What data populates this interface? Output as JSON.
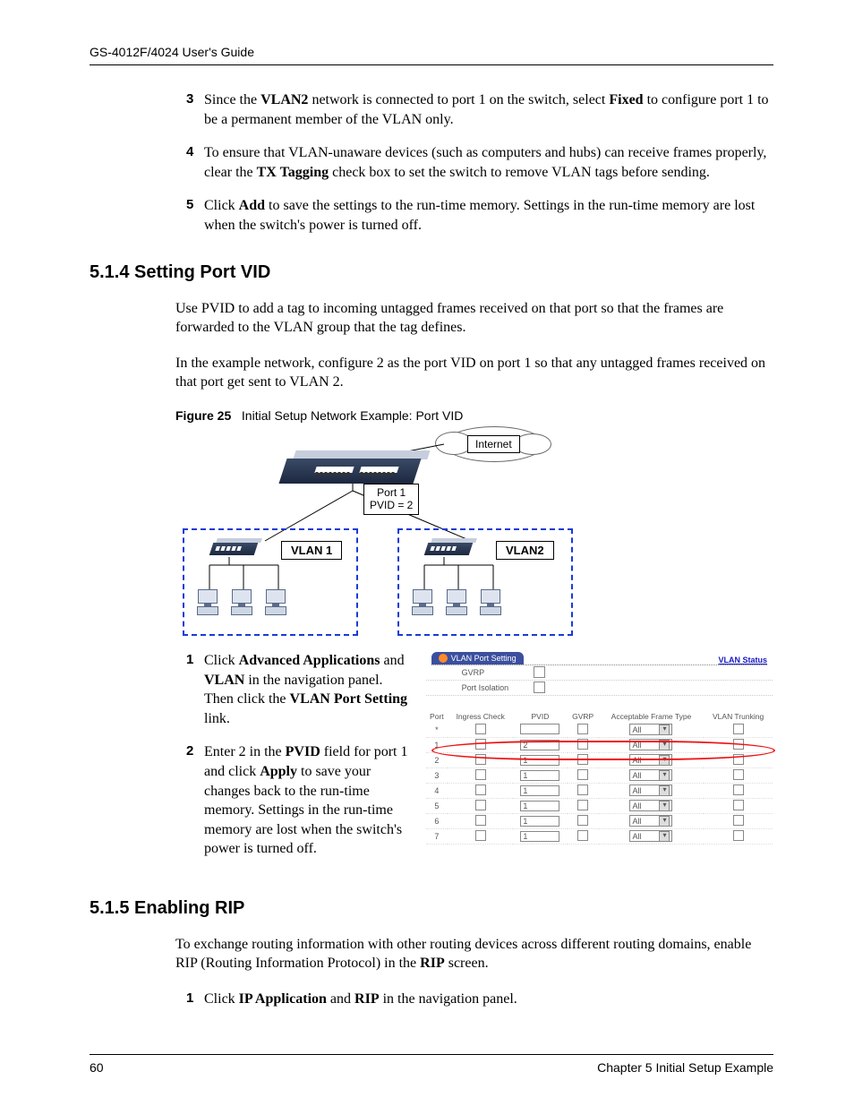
{
  "header": {
    "guide_title": "GS-4012F/4024 User's Guide"
  },
  "footer": {
    "page_number": "60",
    "chapter": "Chapter 5 Initial Setup Example"
  },
  "steps_top": [
    {
      "n": "3",
      "pre": "Since the ",
      "b1": "VLAN2",
      "mid1": " network is connected to port 1 on the switch, select ",
      "b2": "Fixed",
      "post": " to configure port 1 to be a permanent member of the VLAN only."
    },
    {
      "n": "4",
      "pre": "To ensure that VLAN-unaware devices (such as computers and hubs) can receive frames properly, clear the ",
      "b1": "TX Tagging",
      "post": " check box to set the switch to remove VLAN tags before sending."
    },
    {
      "n": "5",
      "pre": "Click ",
      "b1": "Add",
      "post": " to save the settings to the run-time memory. Settings in the run-time memory are lost when the switch's power is turned off."
    }
  ],
  "section_514": {
    "heading": "5.1.4  Setting Port VID",
    "p1": "Use PVID to add a tag to incoming untagged frames received on that port so that the frames are forwarded to the VLAN group that the tag defines.",
    "p2": "In the example network, configure 2 as the port VID on port 1 so that any untagged frames received on that port get sent to VLAN 2.",
    "fig_label": "Figure 25",
    "fig_title": "Initial Setup Network Example: Port VID",
    "diagram": {
      "internet": "Internet",
      "port_label_l1": "Port 1",
      "port_label_l2": "PVID = 2",
      "vlan1": "VLAN 1",
      "vlan2": "VLAN2"
    },
    "steps": [
      {
        "n": "1",
        "parts": [
          "Click ",
          "Advanced Applications",
          " and ",
          "VLAN",
          " in the navigation panel. Then click the ",
          "VLAN Port Setting",
          " link."
        ]
      },
      {
        "n": "2",
        "parts": [
          "Enter 2 in the ",
          "PVID",
          " field for port 1 and click ",
          "Apply",
          " to save your changes back to the run-time memory. Settings in the run-time memory are lost when the switch's power is turned off."
        ]
      }
    ],
    "screenshot": {
      "tab_title": "VLAN Port Setting",
      "vlan_status_link": "VLAN Status",
      "gvrp_label": "GVRP",
      "port_isolation_label": "Port Isolation",
      "columns": [
        "Port",
        "Ingress Check",
        "PVID",
        "GVRP",
        "Acceptable Frame Type",
        "VLAN Trunking"
      ],
      "rows": [
        {
          "port": "*",
          "pvid": "",
          "aft": "All"
        },
        {
          "port": "1",
          "pvid": "2",
          "aft": "All",
          "highlight": true
        },
        {
          "port": "2",
          "pvid": "1",
          "aft": "All"
        },
        {
          "port": "3",
          "pvid": "1",
          "aft": "All"
        },
        {
          "port": "4",
          "pvid": "1",
          "aft": "All"
        },
        {
          "port": "5",
          "pvid": "1",
          "aft": "All"
        },
        {
          "port": "6",
          "pvid": "1",
          "aft": "All"
        },
        {
          "port": "7",
          "pvid": "1",
          "aft": "All"
        }
      ]
    }
  },
  "section_515": {
    "heading": "5.1.5  Enabling RIP",
    "p1_pre": "To exchange routing information with other routing devices across different routing domains, enable RIP (Routing Information Protocol) in the ",
    "p1_b": "RIP",
    "p1_post": " screen.",
    "step1_pre": "Click ",
    "step1_b1": "IP Application",
    "step1_mid": " and ",
    "step1_b2": "RIP",
    "step1_post": " in the navigation panel."
  }
}
